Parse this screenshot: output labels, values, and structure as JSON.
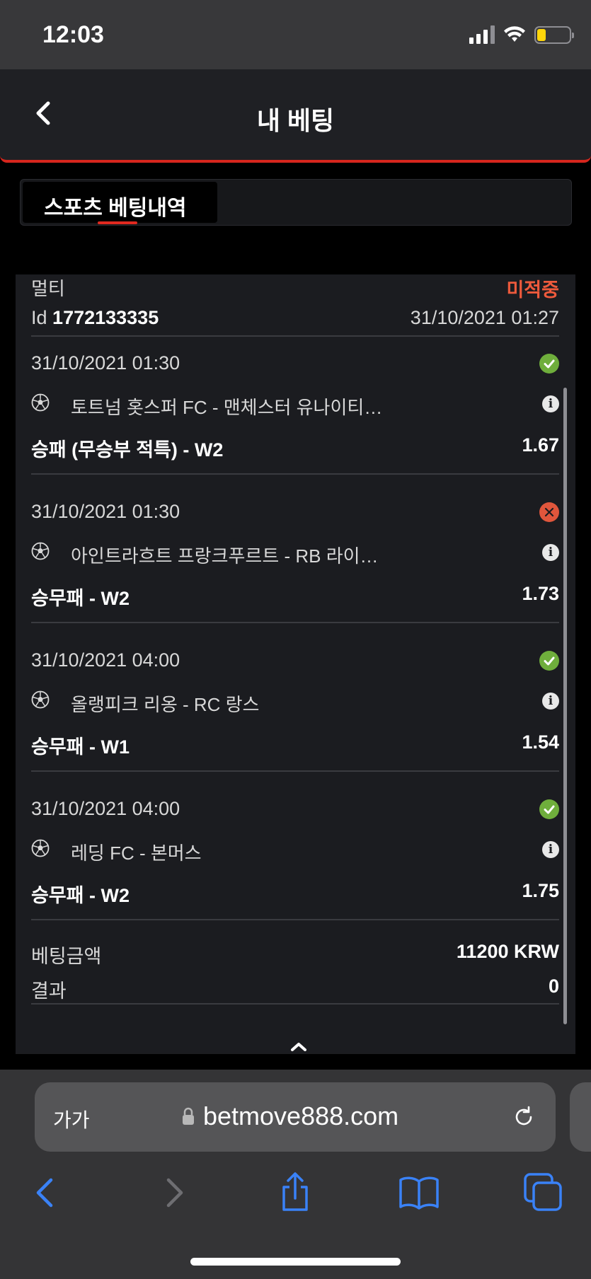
{
  "status_bar": {
    "time": "12:03"
  },
  "header": {
    "title": "내 베팅"
  },
  "tabs": [
    {
      "label": "스포츠 베팅내역",
      "active": true
    }
  ],
  "bet": {
    "type": "멀티",
    "status": "미적중",
    "id_prefix": "Id",
    "id": "1772133335",
    "placed_at": "31/10/2021 01:27",
    "legs": [
      {
        "time": "31/10/2021 01:30",
        "result": "win",
        "match": "토트넘 홋스퍼 FC - 맨체스터 유나이티…",
        "market": "승패 (무승부 적특) - W2",
        "odds": "1.67"
      },
      {
        "time": "31/10/2021 01:30",
        "result": "lose",
        "match": "아인트라흐트 프랑크푸르트 - RB 라이…",
        "market": "승무패 - W2",
        "odds": "1.73"
      },
      {
        "time": "31/10/2021 04:00",
        "result": "win",
        "match": "올랭피크 리옹 - RC 랑스",
        "market": "승무패 - W1",
        "odds": "1.54"
      },
      {
        "time": "31/10/2021 04:00",
        "result": "win",
        "match": "레딩 FC - 본머스",
        "market": "승무패 - W2",
        "odds": "1.75"
      }
    ],
    "stake_label": "베팅금액",
    "stake_value": "11200 KRW",
    "result_label": "결과",
    "result_value": "0"
  },
  "browser": {
    "aa_label": "가가",
    "url": "betmove888.com"
  },
  "colors": {
    "accent": "#d7261d",
    "lose": "#ee5a3c",
    "win": "#6fae3c",
    "link_blue": "#3a82f7"
  }
}
